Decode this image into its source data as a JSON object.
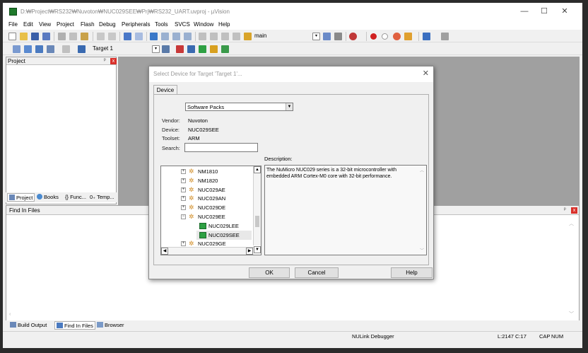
{
  "window": {
    "title": "D:₩Project₩RS232₩Nuvoton₩NUC029SEE₩Prj₩RS232_UART.uvproj - µVision",
    "minimize": "—",
    "maximize": "☐",
    "close": "✕"
  },
  "menu": [
    "File",
    "Edit",
    "View",
    "Project",
    "Flash",
    "Debug",
    "Peripherals",
    "Tools",
    "SVCS",
    "Window",
    "Help"
  ],
  "toolbar1": {
    "target_combo": "main"
  },
  "toolbar2": {
    "target_name": "Target 1"
  },
  "project_panel": {
    "title": "Project",
    "pin": "ᵖ",
    "close": "x",
    "tabs": [
      "Project",
      "Books",
      "{} Func...",
      "0₊ Temp..."
    ]
  },
  "find_panel": {
    "title": "Find In Files",
    "pin": "ᵖ",
    "close": "x"
  },
  "bottom_tabs": [
    "Build Output",
    "Find In Files",
    "Browser"
  ],
  "status": {
    "debugger": "NULink Debugger",
    "position": "L:2147 C:17",
    "caps": "CAP",
    "num": "NUM"
  },
  "dialog": {
    "title": "Select Device for Target 'Target 1'...",
    "tab": "Device",
    "packs_select": "Software Packs",
    "vendor_label": "Vendor:",
    "vendor_value": "Nuvoton",
    "device_label": "Device:",
    "device_value": "NUC029SEE",
    "toolset_label": "Toolset:",
    "toolset_value": "ARM",
    "search_label": "Search:",
    "search_value": "",
    "description_label": "Description:",
    "description": "The NuMicro NUC029 series is a 32-bit microcontroller with embedded ARM Cortex-M0 core with 32-bit performance.",
    "tree": [
      {
        "label": "NM1810",
        "type": "family",
        "expander": "+"
      },
      {
        "label": "NM1820",
        "type": "family",
        "expander": "+"
      },
      {
        "label": "NUC029AE",
        "type": "family",
        "expander": "+"
      },
      {
        "label": "NUC029AN",
        "type": "family",
        "expander": "+"
      },
      {
        "label": "NUC029DE",
        "type": "family",
        "expander": "+"
      },
      {
        "label": "NUC029EE",
        "type": "family",
        "expander": "−"
      },
      {
        "label": "NUC029LEE",
        "type": "device",
        "expander": ""
      },
      {
        "label": "NUC029SEE",
        "type": "device",
        "expander": ""
      },
      {
        "label": "NUC029GE",
        "type": "family",
        "expander": "+"
      }
    ],
    "ok": "OK",
    "cancel": "Cancel",
    "help": "Help"
  },
  "colors": {
    "workspace_gray": "#a0a0a0",
    "close_red": "#d9302a",
    "chip_green": "#2ea043",
    "selected_row": "#e8e8e8"
  }
}
